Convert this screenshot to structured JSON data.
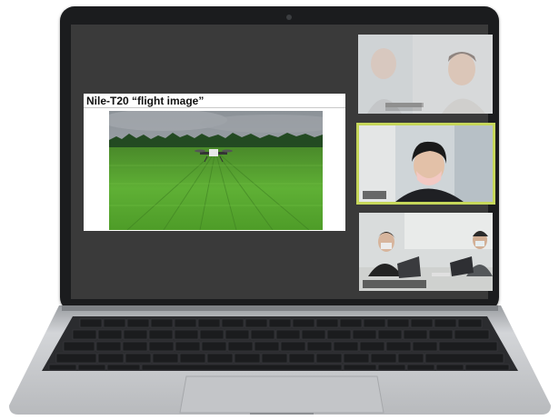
{
  "slide": {
    "title": "Nile-T20  “flight image”",
    "photo": "drone-over-rice-field"
  },
  "participants": [
    {
      "tile": "participant-tile-1",
      "state": "faded"
    },
    {
      "tile": "participant-tile-2",
      "state": "active-speaker",
      "highlight_color": "#c6d75a"
    },
    {
      "tile": "participant-tile-3",
      "state": "normal"
    }
  ],
  "device": {
    "icon": "laptop-icon",
    "colors": {
      "bezel": "#1b1c1e",
      "screen_bg": "#3a3a3a",
      "body": "#c9cbce"
    }
  }
}
